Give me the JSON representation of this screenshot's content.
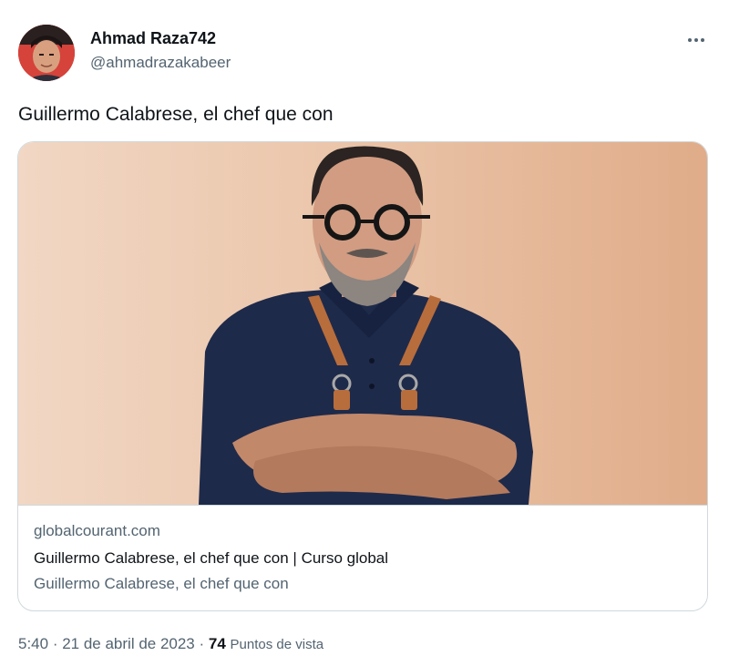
{
  "author": {
    "display_name": "Ahmad Raza742",
    "handle": "@ahmadrazakabeer"
  },
  "tweet": {
    "text": "Guillermo Calabrese, el chef que con"
  },
  "card": {
    "domain": "globalcourant.com",
    "title": "Guillermo Calabrese, el chef que con | Curso global",
    "description": "Guillermo Calabrese, el chef que con"
  },
  "meta": {
    "time": "5:40",
    "separator": " · ",
    "date": "21 de abril de 2023",
    "views_count": "74",
    "views_label": "Puntos de vista"
  },
  "icons": {
    "more": "more-horizontal-icon"
  },
  "colors": {
    "text_primary": "#0f1419",
    "text_secondary": "#536471",
    "border": "#cfd9de",
    "card_background": "#ebc6ab"
  }
}
